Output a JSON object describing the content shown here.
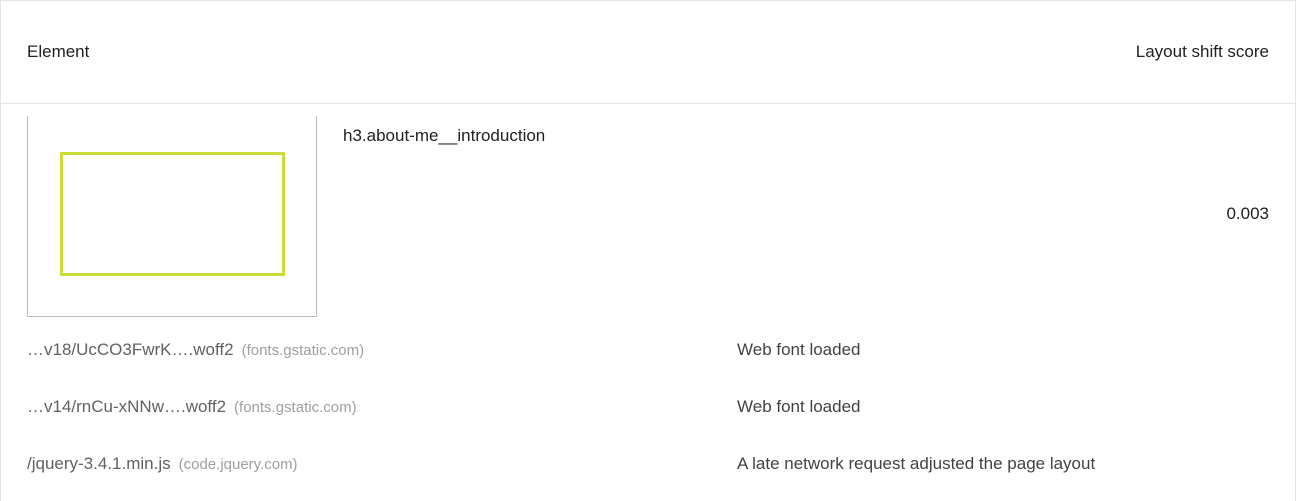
{
  "header": {
    "element_label": "Element",
    "score_label": "Layout shift score"
  },
  "item": {
    "selector": "h3.about-me__introduction",
    "score": "0.003",
    "highlight_color": "#cddc39"
  },
  "subitems": [
    {
      "url": "…v18/UcCO3FwrK….woff2",
      "host": "(fonts.gstatic.com)",
      "reason": "Web font loaded"
    },
    {
      "url": "…v14/rnCu-xNNw….woff2",
      "host": "(fonts.gstatic.com)",
      "reason": "Web font loaded"
    },
    {
      "url": "/jquery-3.4.1.min.js",
      "host": "(code.jquery.com)",
      "reason": "A late network request adjusted the page layout"
    }
  ]
}
